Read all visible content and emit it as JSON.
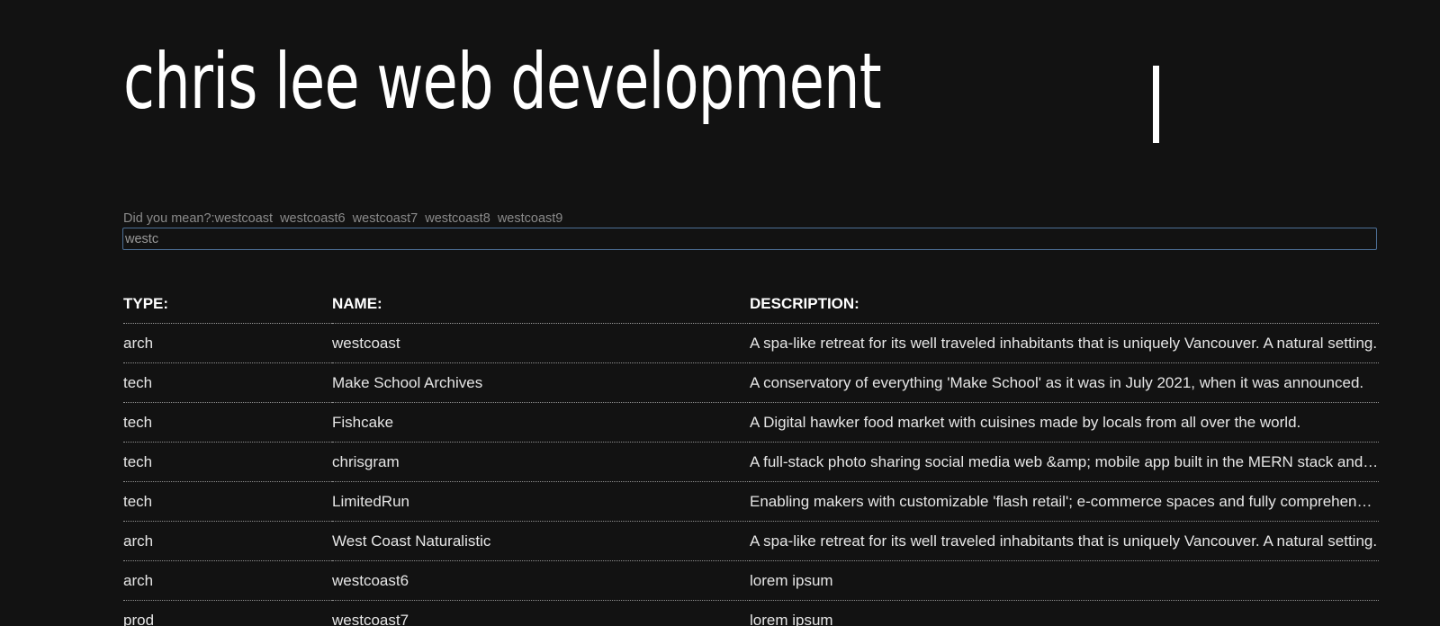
{
  "header": {
    "title": "chris lee web development"
  },
  "search": {
    "suggest_prefix": "Did you mean?:",
    "suggestions": [
      "westcoast",
      "westcoast6",
      "westcoast7",
      "westcoast8",
      "westcoast9"
    ],
    "value": "westc"
  },
  "table": {
    "headers": {
      "type": "TYPE:",
      "name": "NAME:",
      "description": "DESCRIPTION:"
    },
    "rows": [
      {
        "type": "arch",
        "name": "westcoast",
        "description": "A spa-like retreat for its well traveled inhabitants that is uniquely Vancouver. A natural setting."
      },
      {
        "type": "tech",
        "name": "Make School Archives",
        "description": "A conservatory of everything 'Make School' as it was in July 2021, when it was announced."
      },
      {
        "type": "tech",
        "name": "Fishcake",
        "description": "A Digital hawker food market with cuisines made by locals from all over the world."
      },
      {
        "type": "tech",
        "name": "chrisgram",
        "description": "A full-stack photo sharing social media web &amp; mobile app built in the MERN stack and more."
      },
      {
        "type": "tech",
        "name": "LimitedRun",
        "description": "Enabling makers with customizable 'flash retail'; e-commerce spaces and fully comprehensive tools."
      },
      {
        "type": "arch",
        "name": "West Coast Naturalistic",
        "description": "A spa-like retreat for its well traveled inhabitants that is uniquely Vancouver. A natural setting."
      },
      {
        "type": "arch",
        "name": "westcoast6",
        "description": "lorem ipsum"
      },
      {
        "type": "prod",
        "name": "westcoast7",
        "description": "lorem ipsum"
      }
    ]
  }
}
